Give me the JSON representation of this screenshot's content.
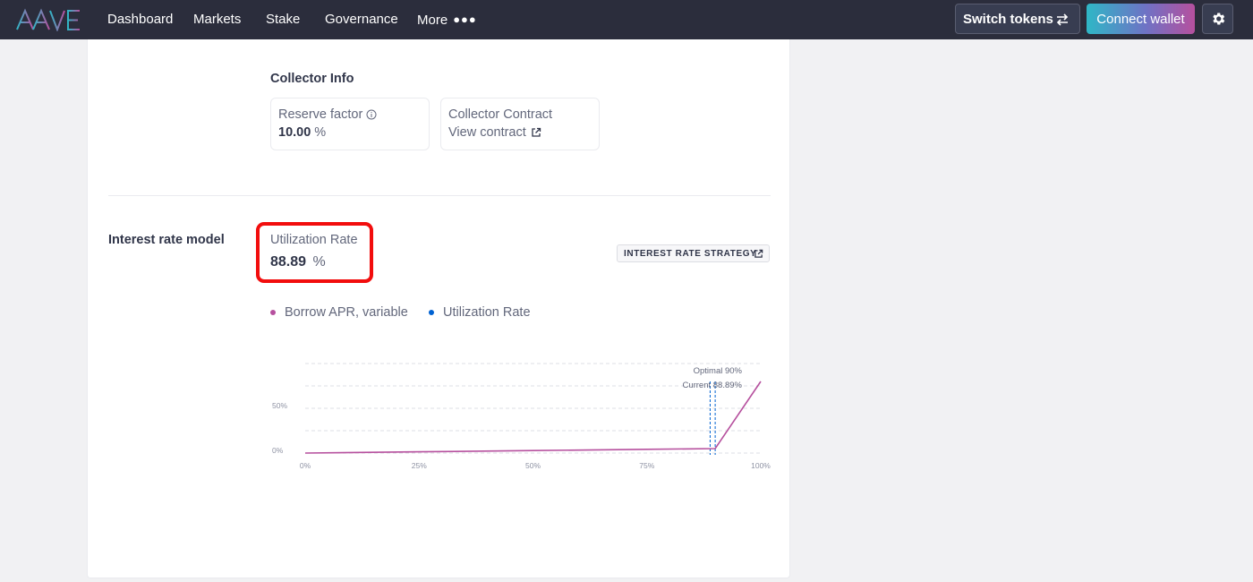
{
  "brand": {
    "logo_text": "AAVE"
  },
  "nav": {
    "items": [
      {
        "label": "Dashboard"
      },
      {
        "label": "Markets"
      },
      {
        "label": "Stake"
      },
      {
        "label": "Governance"
      },
      {
        "label": "More"
      }
    ],
    "switch_tokens_label": "Switch tokens",
    "connect_wallet_label": "Connect wallet"
  },
  "collector": {
    "title": "Collector Info",
    "reserve_factor_label": "Reserve factor",
    "reserve_factor_value": "10.00",
    "reserve_factor_unit": "%",
    "contract_label": "Collector Contract",
    "contract_link": "View contract"
  },
  "interest": {
    "title": "Interest rate model",
    "utilization_label": "Utilization Rate",
    "utilization_value": "88.89",
    "utilization_unit": "%",
    "strategy_button": "INTEREST RATE STRATEGY"
  },
  "colors": {
    "borrow_series": "#b6509e",
    "utilization_series": "#0062d2",
    "highlight": "#f20d0d",
    "topbar": "#2b2d3c"
  },
  "chart_data": {
    "type": "line",
    "x_ticks": [
      "0%",
      "25%",
      "50%",
      "75%",
      "100%"
    ],
    "y_ticks": [
      "0%",
      "50%"
    ],
    "xlim": [
      0,
      100
    ],
    "ylim": [
      0,
      100
    ],
    "grid": true,
    "legend_position": "top-left",
    "series": [
      {
        "name": "Borrow APR, variable",
        "x": [
          0,
          25,
          50,
          75,
          90,
          100
        ],
        "y": [
          0,
          1.4,
          2.8,
          4.2,
          5,
          80
        ]
      },
      {
        "name": "Utilization Rate",
        "x": [
          88.89
        ],
        "y": [
          0
        ]
      }
    ],
    "annotations": [
      {
        "label": "Optimal 90%",
        "x": 90
      },
      {
        "label": "Current 88.89%",
        "x": 88.89
      }
    ]
  }
}
